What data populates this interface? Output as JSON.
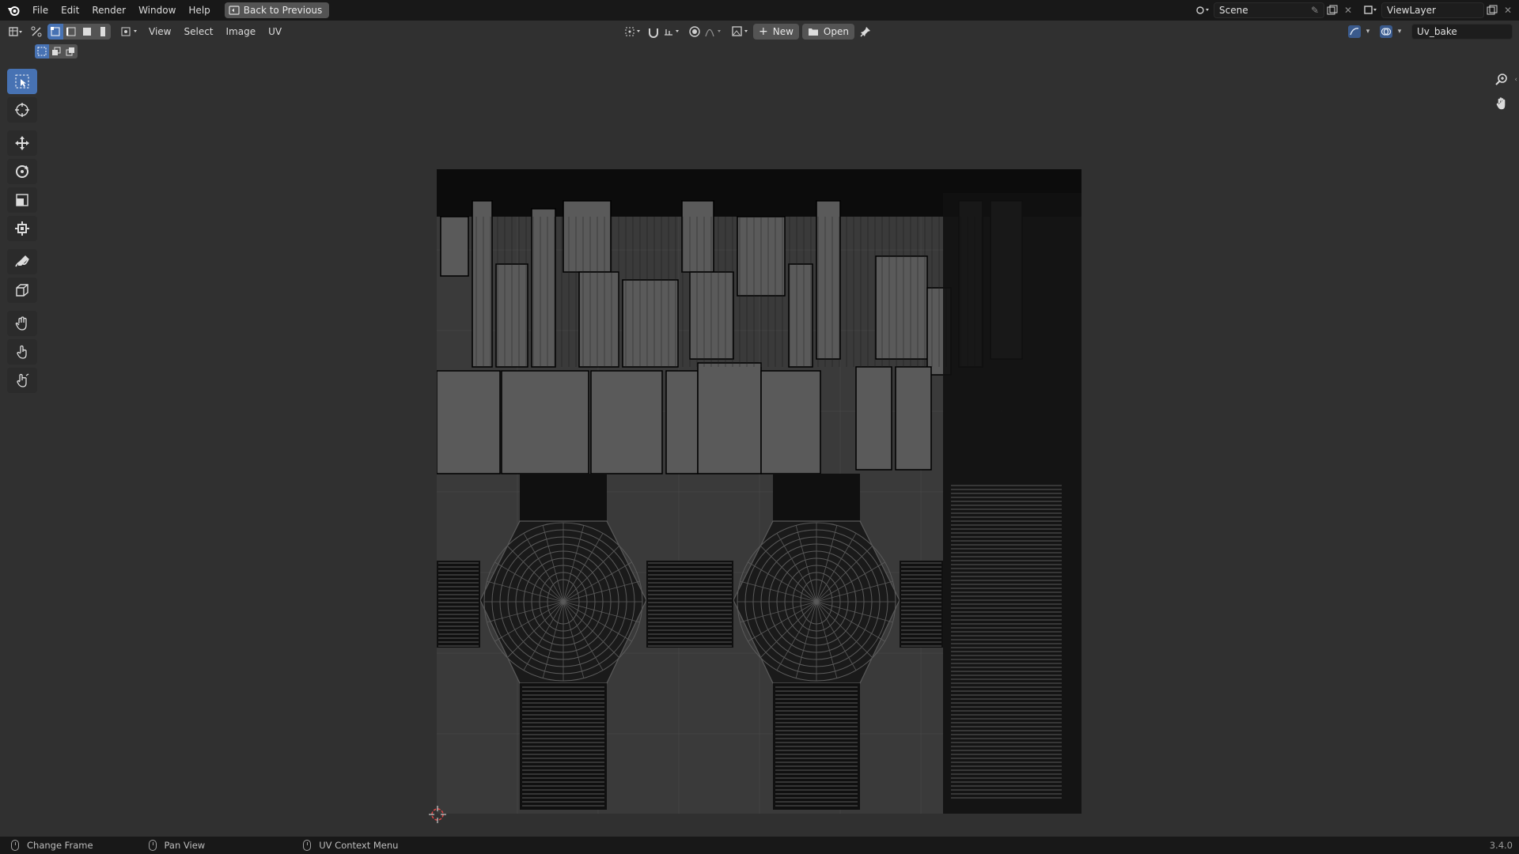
{
  "topbar": {
    "menus": [
      "File",
      "Edit",
      "Render",
      "Window",
      "Help"
    ],
    "back_button": "Back to Previous",
    "scene": "Scene",
    "view_layer": "ViewLayer"
  },
  "header": {
    "menus": [
      "View",
      "Select",
      "Image",
      "UV"
    ],
    "new_label": "New",
    "open_label": "Open",
    "image_name": "Uv_bake"
  },
  "toolbar": {
    "tools": [
      "Tweak",
      "Cursor",
      "Move",
      "Rotate",
      "Scale",
      "Transform",
      "Annotate",
      "Rip Region",
      "Grab",
      "Relax",
      "Pinch"
    ],
    "active_tool": "Tweak"
  },
  "statusbar": {
    "left": "Change Frame",
    "middle": "Pan View",
    "right": "UV Context Menu",
    "version": "3.4.0"
  },
  "colors": {
    "accent": "#4772b3",
    "panel": "#303030",
    "topbar": "#181818",
    "uv_face": "#5a5a5a",
    "uv_edge": "#000000"
  },
  "icons": {
    "logo": "blender-logo-icon",
    "zoom": "zoom-icon",
    "pan": "hand-icon",
    "cursor": "2d-cursor-icon"
  }
}
